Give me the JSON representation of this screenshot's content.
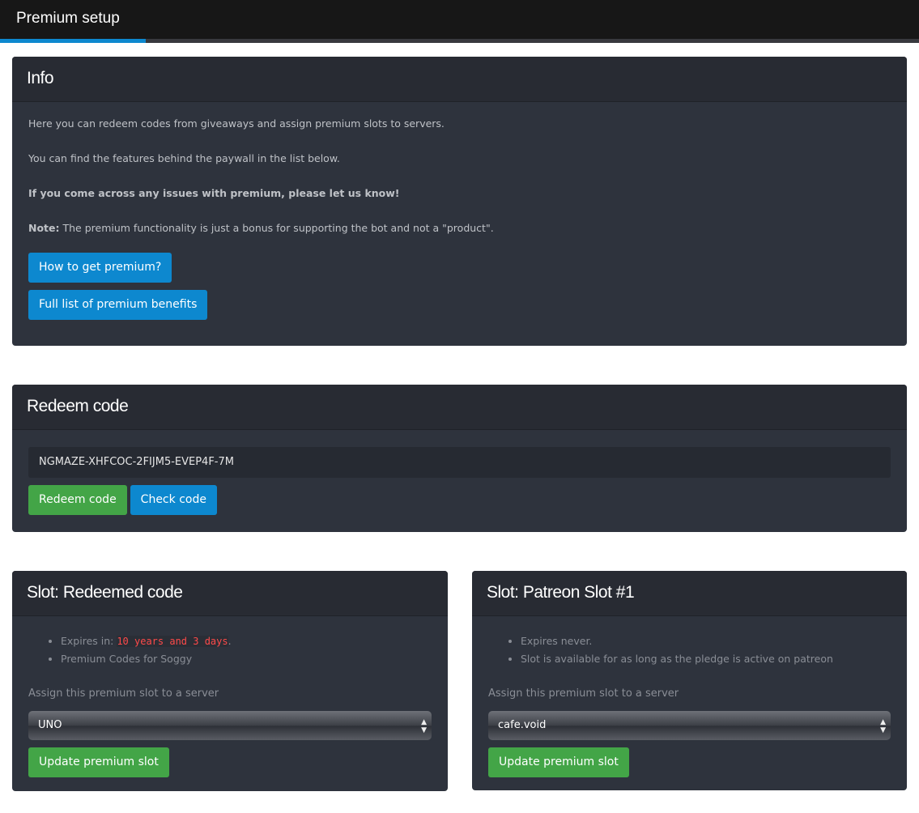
{
  "header": {
    "title": "Premium setup"
  },
  "info": {
    "title": "Info",
    "p1": "Here you can redeem codes from giveaways and assign premium slots to servers.",
    "p2": "You can find the features behind the paywall in the list below.",
    "p3": "If you come across any issues with premium, please let us know!",
    "p4_bold": "Note:",
    "p4": " The premium functionality is just a bonus for supporting the bot and not a \"product\".",
    "btn1": "How to get premium?",
    "btn2": "Full list of premium benefits"
  },
  "redeem": {
    "title": "Redeem code",
    "value": "NGMAZE-XHFCOC-2FIJM5-EVEP4F-7M",
    "redeem_label": "Redeem code",
    "check_label": "Check code"
  },
  "slots": [
    {
      "title": "Slot: Redeemed code",
      "expires_prefix": "Expires in: ",
      "expires_value": "10 years and 3 days",
      "expires_suffix": ".",
      "note": "Premium Codes for Soggy",
      "assign_label": "Assign this premium slot to a server",
      "server": "UNO",
      "update_label": "Update premium slot"
    },
    {
      "title": "Slot: Patreon Slot #1",
      "expires_text": "Expires never.",
      "note": "Slot is available for as long as the pledge is active on patreon",
      "assign_label": "Assign this premium slot to a server",
      "server": "cafe.void",
      "update_label": "Update premium slot"
    }
  ]
}
